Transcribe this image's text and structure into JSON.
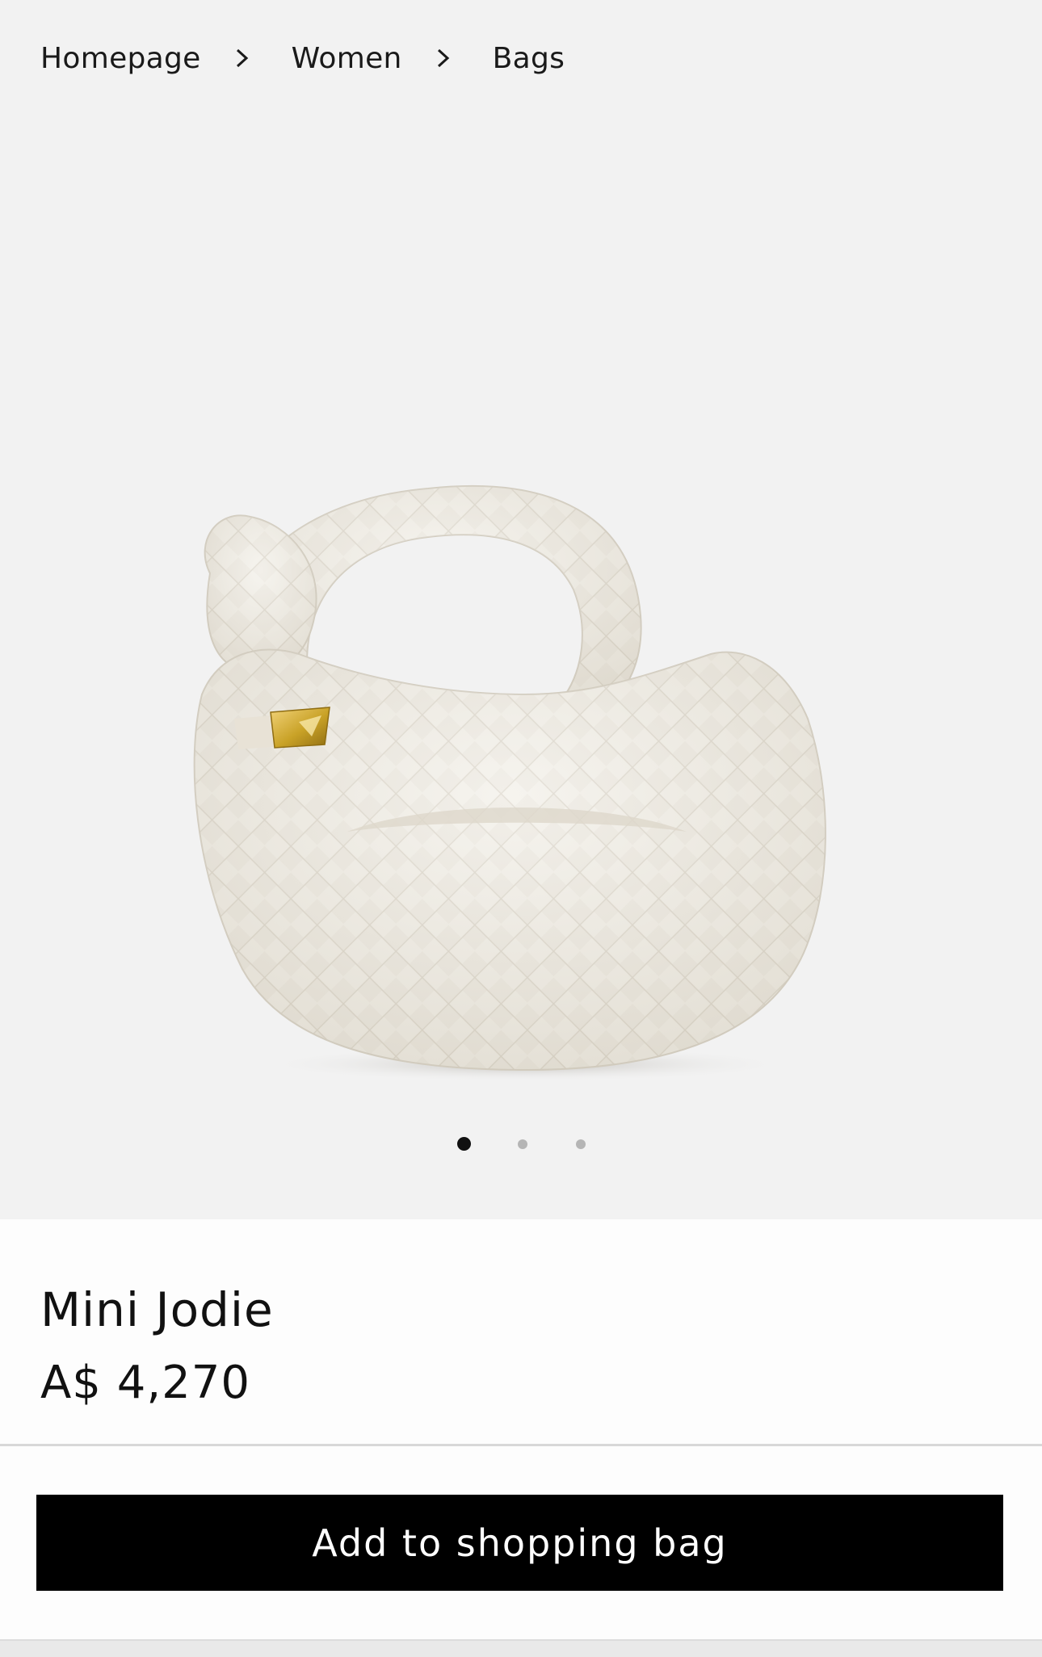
{
  "breadcrumb": {
    "items": [
      "Homepage",
      "Women",
      "Bags"
    ]
  },
  "gallery": {
    "image_alt": "Mini Jodie woven leather bag in white",
    "slide_count": 3,
    "active_slide": 1
  },
  "product": {
    "name": "Mini Jodie",
    "price": "A$ 4,270"
  },
  "actions": {
    "add_to_bag_label": "Add to shopping bag"
  },
  "colors": {
    "gallery_bg": "#f2f2f2",
    "button_bg": "#000000",
    "button_text": "#ffffff",
    "bag_leather": "#f1eee6",
    "hardware_gold": "#c9a227"
  },
  "icons": {
    "breadcrumb_separator": "chevron-right-icon"
  }
}
